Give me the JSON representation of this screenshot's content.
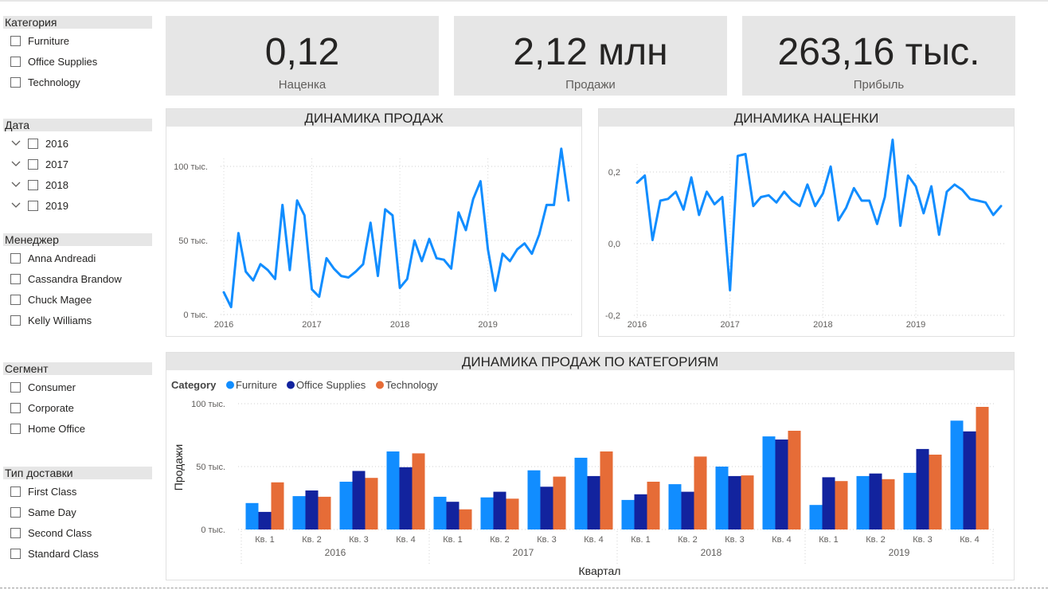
{
  "slicers": {
    "category": {
      "title": "Категория",
      "items": [
        "Furniture",
        "Office Supplies",
        "Technology"
      ]
    },
    "date": {
      "title": "Дата",
      "items": [
        "2016",
        "2017",
        "2018",
        "2019"
      ]
    },
    "manager": {
      "title": "Менеджер",
      "items": [
        "Anna Andreadi",
        "Cassandra Brandow",
        "Chuck Magee",
        "Kelly Williams"
      ]
    },
    "segment": {
      "title": "Сегмент",
      "items": [
        "Consumer",
        "Corporate",
        "Home Office"
      ]
    },
    "shipping": {
      "title": "Тип доставки",
      "items": [
        "First Class",
        "Same Day",
        "Second Class",
        "Standard Class"
      ]
    }
  },
  "cards": [
    {
      "value": "0,12",
      "label": "Наценка"
    },
    {
      "value": "2,12 млн",
      "label": "Продажи"
    },
    {
      "value": "263,16 тыс.",
      "label": "Прибыль"
    }
  ],
  "chart_data": [
    {
      "type": "line",
      "title": "ДИНАМИКА ПРОДАЖ",
      "color": "#118dff",
      "x_start": "2016-01",
      "x_ticks": [
        "2016",
        "2017",
        "2018",
        "2019"
      ],
      "y_ticks": [
        "0 тыс.",
        "50 тыс.",
        "100 тыс."
      ],
      "ylim": [
        0,
        100000
      ],
      "values": [
        15000,
        5000,
        55000,
        29000,
        23000,
        34000,
        30000,
        24000,
        74000,
        30000,
        77000,
        67000,
        17000,
        12000,
        38000,
        31000,
        26000,
        25000,
        29000,
        34000,
        62000,
        26000,
        71000,
        67000,
        18000,
        24000,
        50000,
        36000,
        51000,
        38000,
        37000,
        31000,
        69000,
        57000,
        78000,
        90000,
        44000,
        16000,
        41000,
        36000,
        44000,
        48000,
        41000,
        54000,
        74000,
        74000,
        112000,
        77000
      ]
    },
    {
      "type": "line",
      "title": "ДИНАМИКА НАЦЕНКИ",
      "color": "#118dff",
      "x_start": "2016-01",
      "x_ticks": [
        "2016",
        "2017",
        "2018",
        "2019"
      ],
      "y_ticks": [
        "-0,2",
        "0,0",
        "0,2"
      ],
      "ylim": [
        -0.2,
        0.2
      ],
      "values": [
        0.17,
        0.19,
        0.01,
        0.12,
        0.125,
        0.145,
        0.095,
        0.185,
        0.08,
        0.145,
        0.11,
        0.13,
        -0.13,
        0.245,
        0.25,
        0.105,
        0.13,
        0.135,
        0.115,
        0.145,
        0.12,
        0.105,
        0.165,
        0.105,
        0.14,
        0.215,
        0.065,
        0.1,
        0.155,
        0.12,
        0.12,
        0.055,
        0.13,
        0.29,
        0.05,
        0.19,
        0.16,
        0.085,
        0.16,
        0.025,
        0.145,
        0.165,
        0.15,
        0.125,
        0.12,
        0.115,
        0.08,
        0.105
      ]
    },
    {
      "type": "bar",
      "title": "ДИНАМИКА ПРОДАЖ ПО КАТЕГОРИЯМ",
      "legend_title": "Category",
      "xlabel": "Квартал",
      "ylabel": "Продажи",
      "y_ticks": [
        "0 тыс.",
        "50 тыс.",
        "100 тыс."
      ],
      "ylim": [
        0,
        100000
      ],
      "years": [
        "2016",
        "2017",
        "2018",
        "2019"
      ],
      "categories": [
        "Кв. 1",
        "Кв. 2",
        "Кв. 3",
        "Кв. 4",
        "Кв. 1",
        "Кв. 2",
        "Кв. 3",
        "Кв. 4",
        "Кв. 1",
        "Кв. 2",
        "Кв. 3",
        "Кв. 4",
        "Кв. 1",
        "Кв. 2",
        "Кв. 3",
        "Кв. 4"
      ],
      "series": [
        {
          "name": "Furniture",
          "color": "#118dff",
          "values": [
            21000,
            26500,
            38000,
            62000,
            26000,
            25500,
            47000,
            57000,
            23500,
            36000,
            50000,
            74000,
            19500,
            42500,
            45000,
            86500
          ]
        },
        {
          "name": "Office Supplies",
          "color": "#12239e",
          "values": [
            14000,
            31000,
            46500,
            49500,
            22000,
            30000,
            34000,
            42500,
            28000,
            30000,
            42500,
            71500,
            41500,
            44500,
            64000,
            78000
          ]
        },
        {
          "name": "Technology",
          "color": "#e66c37",
          "values": [
            37500,
            26000,
            41000,
            60500,
            16000,
            24500,
            42000,
            62000,
            38000,
            58000,
            43000,
            78500,
            38500,
            40000,
            59500,
            97500
          ]
        }
      ]
    }
  ]
}
